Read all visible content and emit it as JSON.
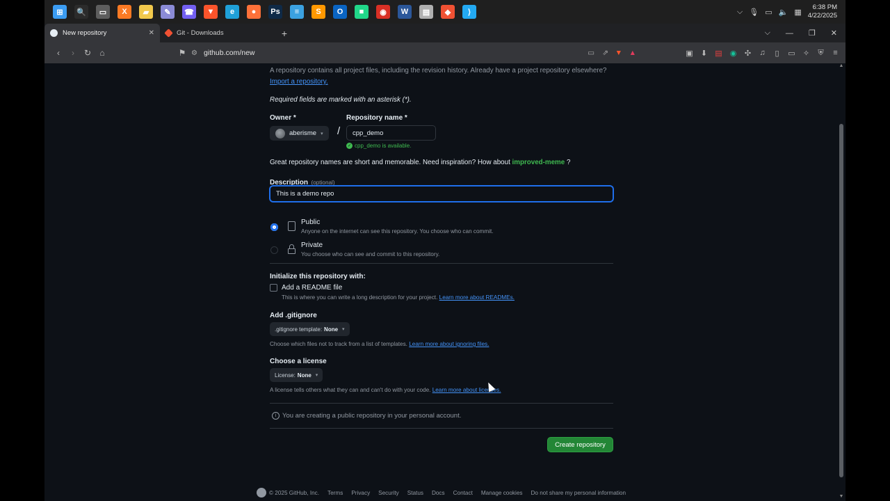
{
  "taskbar": {
    "apps": [
      {
        "name": "windows-start",
        "color": "#3b9cf2",
        "glyph": "⊞"
      },
      {
        "name": "search",
        "color": "#2b2b2b",
        "glyph": "🔍"
      },
      {
        "name": "task-view",
        "color": "#5d5d5d",
        "glyph": "▭"
      },
      {
        "name": "xampp",
        "color": "#fb7a24",
        "glyph": "X"
      },
      {
        "name": "file-explorer",
        "color": "#f2c94c",
        "glyph": "▰"
      },
      {
        "name": "paint",
        "color": "#8b8bd6",
        "glyph": "✎"
      },
      {
        "name": "viber",
        "color": "#7360f2",
        "glyph": "☎"
      },
      {
        "name": "brave",
        "color": "#fb542b",
        "glyph": "▼"
      },
      {
        "name": "edge",
        "color": "#1fa0d8",
        "glyph": "e"
      },
      {
        "name": "firefox",
        "color": "#ff7139",
        "glyph": "●"
      },
      {
        "name": "photoshop",
        "color": "#0f2a47",
        "glyph": "Ps"
      },
      {
        "name": "notepad",
        "color": "#3ba1e0",
        "glyph": "≡"
      },
      {
        "name": "sublime-text",
        "color": "#ff9800",
        "glyph": "S"
      },
      {
        "name": "outlook",
        "color": "#0a64c2",
        "glyph": "O"
      },
      {
        "name": "pycharm",
        "color": "#21d789",
        "glyph": "■"
      },
      {
        "name": "chrome",
        "color": "#d93025",
        "glyph": "◉"
      },
      {
        "name": "word",
        "color": "#2b579a",
        "glyph": "W"
      },
      {
        "name": "pdf-viewer",
        "color": "#b0b0b0",
        "glyph": "▤"
      },
      {
        "name": "git",
        "color": "#f05133",
        "glyph": "◆"
      },
      {
        "name": "vscode",
        "color": "#23a9f2",
        "glyph": "⟩"
      }
    ],
    "time": "6:38 PM",
    "date": "4/22/2025"
  },
  "tabs": [
    {
      "label": "New repository",
      "active": true,
      "favicon_color": "#e6edf3"
    },
    {
      "label": "Git - Downloads",
      "active": false,
      "favicon_color": "#f05133"
    }
  ],
  "address": {
    "url": "github.com/new"
  },
  "page": {
    "intro": "A repository contains all project files, including the revision history. Already have a project repository elsewhere?",
    "import_link": "Import a repository.",
    "required_note": "Required fields are marked with an asterisk (*).",
    "owner_label": "Owner *",
    "owner_value": "aberisme",
    "separator": "/",
    "repo_label": "Repository name *",
    "repo_value": "cpp_demo",
    "available_msg": "cpp_demo is available.",
    "inspiration_prefix": "Great repository names are short and memorable. Need inspiration? How about",
    "inspiration_name": "improved-meme",
    "inspiration_suffix": "?",
    "description_label": "Description",
    "description_optional": "(optional)",
    "description_value": "This is a demo repo",
    "visibility": [
      {
        "title": "Public",
        "desc": "Anyone on the internet can see this repository. You choose who can commit.",
        "selected": true
      },
      {
        "title": "Private",
        "desc": "You choose who can see and commit to this repository.",
        "selected": false
      }
    ],
    "init_heading": "Initialize this repository with:",
    "readme_label": "Add a README file",
    "readme_desc": "This is where you can write a long description for your project.",
    "readme_link": "Learn more about READMEs.",
    "gitignore_heading": "Add .gitignore",
    "gitignore_select_prefix": ".gitignore template:",
    "gitignore_select_value": "None",
    "gitignore_desc": "Choose which files not to track from a list of templates.",
    "gitignore_link": "Learn more about ignoring files.",
    "license_heading": "Choose a license",
    "license_select_prefix": "License:",
    "license_select_value": "None",
    "license_desc": "A license tells others what they can and can't do with your code.",
    "license_link": "Learn more about licenses.",
    "public_notice": "You are creating a public repository in your personal account.",
    "create_button": "Create repository"
  },
  "footer": {
    "copyright": "© 2025 GitHub, Inc.",
    "links": [
      "Terms",
      "Privacy",
      "Security",
      "Status",
      "Docs",
      "Contact",
      "Manage cookies",
      "Do not share my personal information"
    ]
  },
  "colors": {
    "accent_green": "#238636",
    "link_blue": "#4493f8",
    "focus_blue": "#1f6feb",
    "success_green": "#3fb950"
  }
}
